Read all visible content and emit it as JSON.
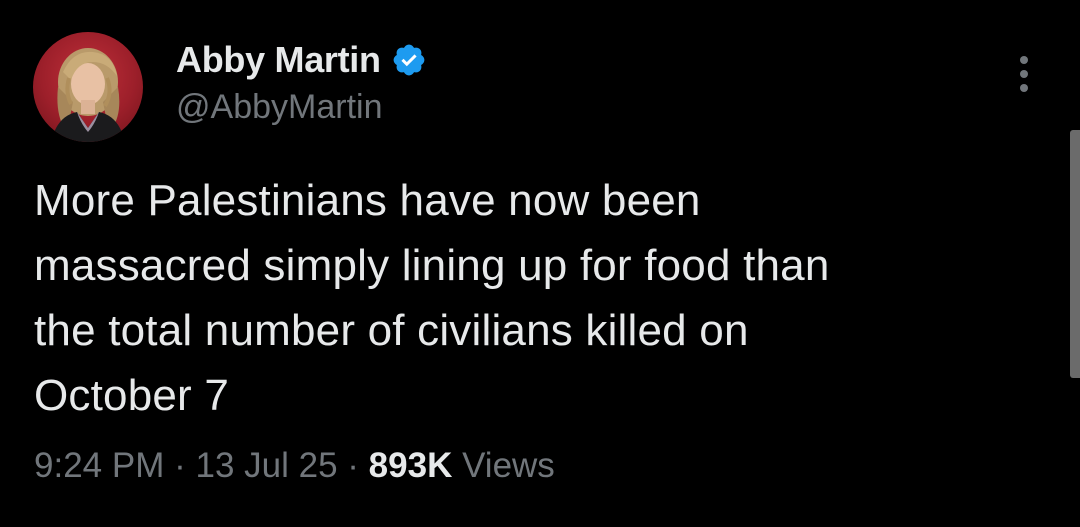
{
  "author": {
    "display_name": "Abby Martin",
    "handle": "@AbbyMartin",
    "verified": true,
    "verified_color": "#1d9bf0",
    "avatar_bg_color": "#b3252f"
  },
  "tweet": {
    "text_lines": [
      "More Palestinians have now been",
      "massacred simply lining up for food than",
      "the total number of civilians killed on",
      "October 7"
    ]
  },
  "meta": {
    "time": "9:24 PM",
    "separator": "·",
    "date": "13 Jul 25",
    "views_count": "893K",
    "views_label": "Views"
  },
  "icons": {
    "more": "more-vertical-icon",
    "verified": "verified-badge-icon"
  },
  "colors": {
    "background": "#000000",
    "primary_text": "#e7e9ea",
    "secondary_text": "#71767b"
  }
}
